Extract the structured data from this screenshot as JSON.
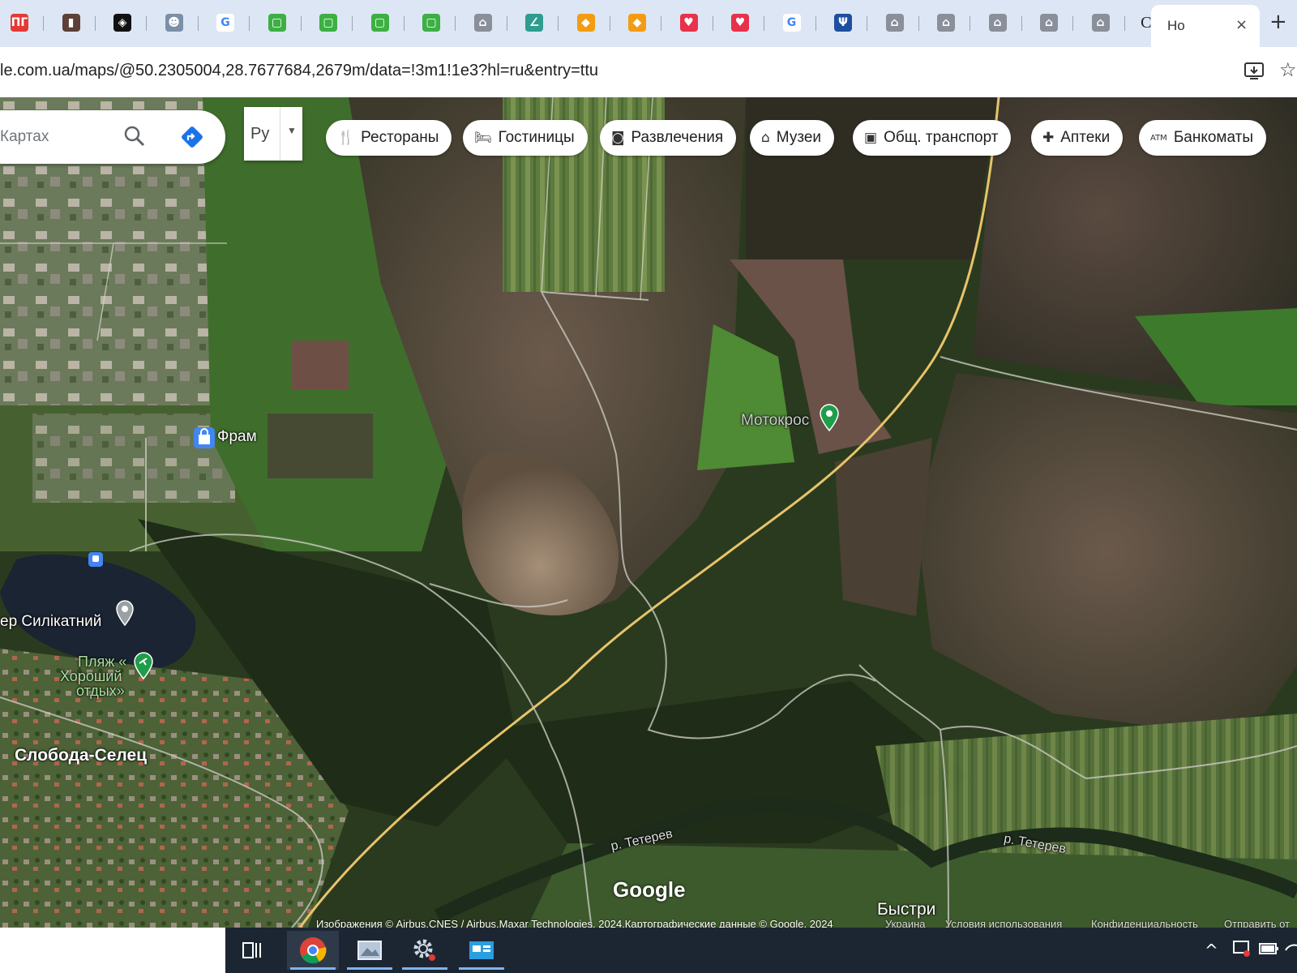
{
  "browser": {
    "tabs": [
      {
        "icon": "red-logo-icon",
        "color": "#e53935",
        "glyph": "ПГ"
      },
      {
        "icon": "briefcase-icon",
        "color": "#5d4037",
        "glyph": "▮"
      },
      {
        "icon": "diamond-logo-icon",
        "color": "#111111",
        "glyph": "◈"
      },
      {
        "icon": "people-photo-icon",
        "color": "#7b8fa8",
        "glyph": "☻"
      },
      {
        "icon": "google-icon",
        "color": "#ffffff",
        "glyph": "G"
      },
      {
        "icon": "green-chat-icon",
        "color": "#3cb043",
        "glyph": "▢"
      },
      {
        "icon": "green-chat-icon",
        "color": "#3cb043",
        "glyph": "▢"
      },
      {
        "icon": "green-chat-icon",
        "color": "#3cb043",
        "glyph": "▢"
      },
      {
        "icon": "green-chat-icon",
        "color": "#3cb043",
        "glyph": "▢"
      },
      {
        "icon": "government-building-icon",
        "color": "#8a8f99",
        "glyph": "⌂"
      },
      {
        "icon": "teal-logo-icon",
        "color": "#2e9c8f",
        "glyph": "∠"
      },
      {
        "icon": "orange-diamond-icon",
        "color": "#f39c12",
        "glyph": "◆"
      },
      {
        "icon": "orange-diamond-icon",
        "color": "#f39c12",
        "glyph": "◆"
      },
      {
        "icon": "red-heart-icon",
        "color": "#e8314a",
        "glyph": "♥"
      },
      {
        "icon": "red-heart-icon",
        "color": "#e8314a",
        "glyph": "♥"
      },
      {
        "icon": "google-icon",
        "color": "#ffffff",
        "glyph": "G"
      },
      {
        "icon": "ukraine-trident-icon",
        "color": "#1d4fa0",
        "glyph": "Ψ"
      },
      {
        "icon": "government-building-icon",
        "color": "#8a8f99",
        "glyph": "⌂"
      },
      {
        "icon": "government-building-icon",
        "color": "#8a8f99",
        "glyph": "⌂"
      },
      {
        "icon": "government-building-icon",
        "color": "#8a8f99",
        "glyph": "⌂"
      },
      {
        "icon": "government-building-icon",
        "color": "#8a8f99",
        "glyph": "⌂"
      },
      {
        "icon": "government-building-icon",
        "color": "#8a8f99",
        "glyph": "⌂"
      },
      {
        "icon": "text-logo-icon",
        "color": "#dde6f4",
        "glyph": "CH"
      }
    ],
    "active_tab": {
      "title": "Но",
      "close": "×"
    },
    "new_tab": "+",
    "url": "le.com.ua/maps/@50.2305004,28.7677684,2679m/data=!3m1!1e3?hl=ru&entry=ttu"
  },
  "map": {
    "search_placeholder": "Картах",
    "language_selector": "Ру",
    "categories": [
      {
        "label": "Рестораны",
        "icon": "restaurant-icon",
        "glyph": "🍴"
      },
      {
        "label": "Гостиницы",
        "icon": "hotel-icon",
        "glyph": "🛏"
      },
      {
        "label": "Развлечения",
        "icon": "camera-icon",
        "glyph": "◙"
      },
      {
        "label": "Музеи",
        "icon": "museum-icon",
        "glyph": "⌂"
      },
      {
        "label": "Общ. транспорт",
        "icon": "bus-icon",
        "glyph": "▣"
      },
      {
        "label": "Аптеки",
        "icon": "pharmacy-icon",
        "glyph": "✚"
      },
      {
        "label": "Банкоматы",
        "icon": "atm-icon",
        "glyph": "ATM"
      }
    ],
    "places": {
      "motocross": "Мотокрос",
      "fram": "Фрам",
      "lake": "ер Силікатний",
      "beach_line1": "Пляж «",
      "beach_line2": "Хороший",
      "beach_line3": "отдых»",
      "village": "Слобода-Селец",
      "river_left": "р. Тетерев",
      "river_right": "р. Тетерев",
      "town": "Быстри"
    },
    "logo": "Google",
    "attribution": "Изображения © Airbus,CNES / Airbus,Maxar Technologies, 2024,Картографические данные © Google, 2024",
    "footer_links": [
      "Украина",
      "Условия использования",
      "Конфиденциальность",
      "Отправить от"
    ]
  },
  "taskbar": {
    "apps": [
      {
        "name": "task-view",
        "glyph": "⊞"
      },
      {
        "name": "chrome",
        "glyph": "●"
      },
      {
        "name": "photos",
        "glyph": "▤"
      },
      {
        "name": "settings",
        "glyph": "⚙"
      },
      {
        "name": "mail",
        "glyph": "✉"
      }
    ]
  }
}
